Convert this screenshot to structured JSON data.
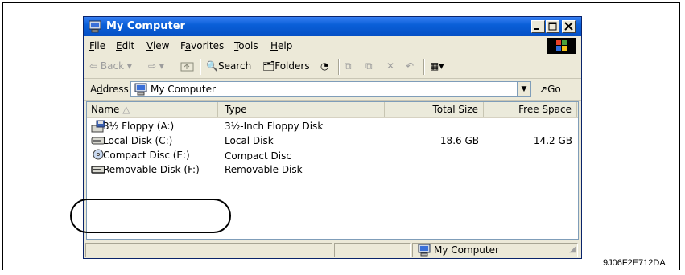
{
  "window": {
    "title": "My Computer",
    "controls": [
      "minimize",
      "maximize",
      "close"
    ]
  },
  "menu": {
    "items": [
      {
        "key": "F",
        "label": "File"
      },
      {
        "key": "E",
        "label": "Edit"
      },
      {
        "key": "V",
        "label": "View"
      },
      {
        "key": "a",
        "label": "Favorites"
      },
      {
        "key": "T",
        "label": "Tools"
      },
      {
        "key": "H",
        "label": "Help"
      }
    ]
  },
  "toolbar": {
    "back_label": "Back",
    "search_label": "Search",
    "folders_label": "Folders"
  },
  "address": {
    "label": "Address",
    "value": "My Computer",
    "go_label": "Go"
  },
  "list": {
    "columns": [
      "Name",
      "Type",
      "Total Size",
      "Free Space"
    ],
    "rows": [
      {
        "name": "3½ Floppy (A:)",
        "type": "3½-Inch Floppy Disk",
        "total": "",
        "free": "",
        "icon": "floppy-drive-icon"
      },
      {
        "name": "Local Disk (C:)",
        "type": "Local Disk",
        "total": "18.6 GB",
        "free": "14.2 GB",
        "icon": "hard-disk-icon"
      },
      {
        "name": "Compact Disc (E:)",
        "type": "Compact Disc",
        "total": "",
        "free": "",
        "icon": "cd-drive-icon"
      },
      {
        "name": "Removable Disk (F:)",
        "type": "Removable Disk",
        "total": "",
        "free": "",
        "icon": "removable-disk-icon"
      }
    ]
  },
  "status": {
    "zone": "My Computer"
  },
  "figure_id": "9J06F2E712DA",
  "colors": {
    "titlebar": "#0a5fd8",
    "chrome": "#ece9d8",
    "list_bg": "#ffffff",
    "highlight_outline": "#000000"
  }
}
